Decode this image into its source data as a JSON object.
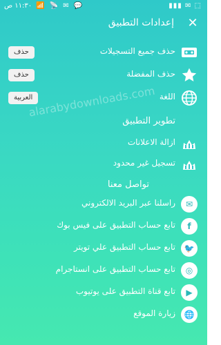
{
  "status_bar": {
    "time": "١١:٣٠ ص",
    "icons_left": "📶 📡 ✉ 💬",
    "icons_right": "▮▮▮ ✉ ⬚"
  },
  "header": {
    "title": "إعدادات التطبيق",
    "close_icon": "close-icon"
  },
  "rows_main": [
    {
      "label": "حذف جميع التسجيلات",
      "chip": "حذف",
      "icon": "tape-icon"
    },
    {
      "label": "حذف المفضلة",
      "chip": "حذف",
      "icon": "star-icon"
    },
    {
      "label": "اللغة",
      "chip": "العربية",
      "icon": "globe-icon"
    }
  ],
  "section_dev": "تطوير التطبيق",
  "rows_dev": [
    {
      "label": "ازالة الاعلانات",
      "icon": "crown-icon"
    },
    {
      "label": "تسجيل غير محدود",
      "icon": "crown-icon"
    }
  ],
  "section_contact": "تواصل معنا",
  "rows_contact": [
    {
      "label": "راسلنا عبر البريد الالكتروني",
      "icon": "email-icon"
    },
    {
      "label": "تابع حساب التطبيق على فيس بوك",
      "icon": "facebook-icon"
    },
    {
      "label": "تابع حساب التطبيق علي تويتر",
      "icon": "twitter-icon"
    },
    {
      "label": "تابع حساب التطبيق على انستاجرام",
      "icon": "instagram-icon"
    },
    {
      "label": "تابع قناة التطبيق على يوتيوب",
      "icon": "youtube-icon"
    },
    {
      "label": "زيارة الموقع",
      "icon": "globe-icon"
    }
  ],
  "watermark": "alarabydownloads.com",
  "colors": {
    "accent": "#2fc9c9",
    "text": "#ffffff",
    "chip_bg": "#f2f2f2"
  }
}
